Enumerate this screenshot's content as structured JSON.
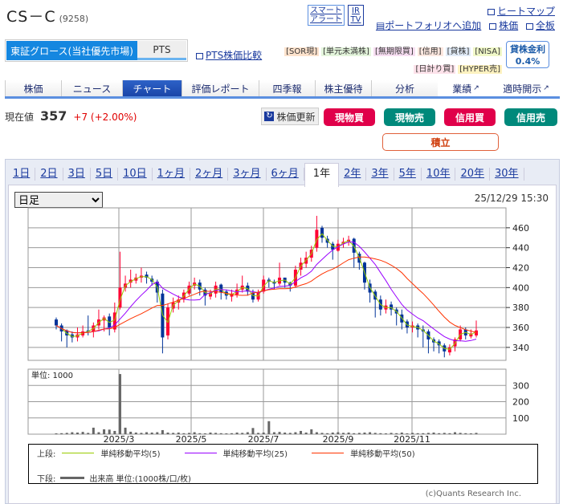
{
  "header": {
    "name": "CS－C",
    "code": "(9258)",
    "smart_alert": [
      "スマート",
      "アラート"
    ],
    "ir_tv": [
      "IR",
      "TV"
    ],
    "links": {
      "heatmap": "ヒートマップ",
      "portfolio": "ポートフォリオへ追加",
      "price": "株価",
      "board": "全板"
    }
  },
  "market": {
    "tabs": [
      "東証グロース(当社優先市場)",
      "PTS"
    ],
    "pts_compare": "PTS株価比較"
  },
  "badges": [
    {
      "label": "[SOR現]",
      "bg": "#fde2cc"
    },
    {
      "label": "[単元未満株]",
      "bg": "#e4f5dc"
    },
    {
      "label": "[無期限買]",
      "bg": "#f7def2"
    },
    {
      "label": "[信用]",
      "bg": "#fde8e0"
    },
    {
      "label": "[貸株]",
      "bg": "#e2ecf8"
    },
    {
      "label": "[NISA]",
      "bg": "#f0f8c8"
    },
    {
      "label": "[日計り買]",
      "bg": "#fde2ea"
    },
    {
      "label": "[HYPER売]",
      "bg": "#fdf2c0"
    }
  ],
  "lending": {
    "label": "貸株金利",
    "rate": "0.4%"
  },
  "nav": [
    "株価",
    "ニュース",
    "チャート",
    "評価レポート",
    "四季報",
    "株主優待",
    "分析",
    "業績",
    "適時開示"
  ],
  "quote": {
    "label": "現在値",
    "price": "357",
    "change": "+7 (+2.00%)"
  },
  "actions": {
    "refresh": "株価更新",
    "cash_buy": "現物買",
    "cash_sell": "現物売",
    "margin_buy": "信用買",
    "margin_sell": "信用売",
    "accumulate": "積立"
  },
  "periods": [
    "1日",
    "2日",
    "3日",
    "5日",
    "10日",
    "1ヶ月",
    "2ヶ月",
    "3ヶ月",
    "6ヶ月",
    "1年",
    "2年",
    "3年",
    "5年",
    "10年",
    "20年",
    "30年"
  ],
  "chart_select": "日足",
  "timestamp": "25/12/29 15:30",
  "chart_data": {
    "type": "candlestick",
    "price_ticks": [
      460,
      440,
      420,
      400,
      380,
      360,
      340
    ],
    "ylim": [
      327,
      480
    ],
    "volume_unit": "単位: 1000",
    "volume_ticks": [
      300,
      200,
      100
    ],
    "volume_ylim": [
      0,
      400
    ],
    "x_labels": [
      "2025/3",
      "2025/5",
      "2025/7",
      "2025/9",
      "2025/11"
    ],
    "close": [
      362,
      356,
      352,
      350,
      353,
      356,
      356,
      362,
      368,
      370,
      360,
      375,
      400,
      404,
      408,
      410,
      412,
      410,
      406,
      395,
      350,
      380,
      385,
      388,
      395,
      402,
      405,
      398,
      392,
      395,
      402,
      395,
      392,
      394,
      398,
      402,
      396,
      388,
      395,
      408,
      406,
      404,
      410,
      405,
      402,
      418,
      425,
      430,
      438,
      458,
      450,
      445,
      438,
      444,
      446,
      448,
      435,
      425,
      405,
      395,
      388,
      378,
      382,
      378,
      374,
      365,
      360,
      362,
      358,
      356,
      348,
      345,
      342,
      336,
      340,
      348,
      358,
      352,
      354,
      357
    ],
    "open": [
      368,
      362,
      357,
      353,
      350,
      352,
      357,
      356,
      362,
      367,
      371,
      358,
      380,
      400,
      405,
      407,
      410,
      413,
      409,
      406,
      394,
      352,
      379,
      385,
      388,
      394,
      402,
      405,
      398,
      391,
      394,
      403,
      396,
      391,
      393,
      398,
      402,
      395,
      388,
      396,
      408,
      406,
      404,
      410,
      405,
      402,
      418,
      424,
      430,
      440,
      460,
      449,
      444,
      437,
      444,
      446,
      449,
      434,
      425,
      404,
      396,
      388,
      378,
      383,
      378,
      373,
      366,
      360,
      362,
      358,
      356,
      348,
      346,
      342,
      335,
      341,
      348,
      358,
      351,
      352
    ],
    "high": [
      370,
      364,
      358,
      356,
      360,
      362,
      372,
      365,
      378,
      372,
      374,
      385,
      436,
      412,
      418,
      414,
      420,
      416,
      412,
      408,
      398,
      384,
      390,
      392,
      398,
      406,
      410,
      408,
      400,
      398,
      406,
      404,
      398,
      398,
      404,
      412,
      405,
      398,
      398,
      412,
      410,
      408,
      425,
      410,
      406,
      422,
      430,
      436,
      442,
      472,
      462,
      452,
      446,
      448,
      450,
      452,
      450,
      436,
      426,
      408,
      398,
      392,
      388,
      386,
      380,
      378,
      368,
      366,
      364,
      362,
      358,
      350,
      348,
      344,
      343,
      350,
      362,
      360,
      358,
      367
    ],
    "low": [
      358,
      346,
      340,
      345,
      346,
      350,
      352,
      350,
      358,
      356,
      352,
      355,
      378,
      396,
      400,
      404,
      405,
      404,
      402,
      385,
      334,
      348,
      375,
      378,
      385,
      392,
      398,
      392,
      382,
      388,
      390,
      388,
      388,
      386,
      390,
      395,
      392,
      385,
      386,
      394,
      400,
      398,
      402,
      400,
      396,
      400,
      412,
      420,
      426,
      436,
      445,
      440,
      428,
      436,
      440,
      442,
      420,
      418,
      398,
      385,
      370,
      372,
      374,
      372,
      362,
      358,
      354,
      355,
      350,
      340,
      334,
      336,
      334,
      330,
      332,
      336,
      346,
      348,
      349,
      350
    ],
    "volume": [
      5,
      6,
      8,
      12,
      10,
      14,
      8,
      40,
      12,
      30,
      28,
      20,
      370,
      40,
      15,
      10,
      8,
      12,
      10,
      12,
      25,
      10,
      8,
      10,
      6,
      8,
      12,
      6,
      5,
      10,
      8,
      6,
      5,
      6,
      10,
      8,
      12,
      38,
      8,
      10,
      80,
      12,
      14,
      10,
      8,
      12,
      20,
      10,
      30,
      12,
      8,
      6,
      10,
      12,
      8,
      10,
      6,
      8,
      10,
      12,
      8,
      6,
      5,
      8,
      6,
      10,
      5,
      8,
      6,
      6,
      8,
      10,
      6,
      8,
      6,
      12,
      8,
      6,
      5,
      8
    ],
    "series": [
      {
        "name": "単純移動平均(5)",
        "color": "#99cc00",
        "window": 5
      },
      {
        "name": "単純移動平均(25)",
        "color": "#9900ff",
        "window": 25
      },
      {
        "name": "単純移動平均(50)",
        "color": "#ff3300",
        "window": 50
      }
    ],
    "legend": {
      "upper": "上段:",
      "lower": "下段:",
      "volume": "出来高 単位:(1000株/口/枚)"
    },
    "up_color": "#ff0033",
    "down_color": "#003399"
  },
  "copyright": "(c)Quants Research Inc."
}
